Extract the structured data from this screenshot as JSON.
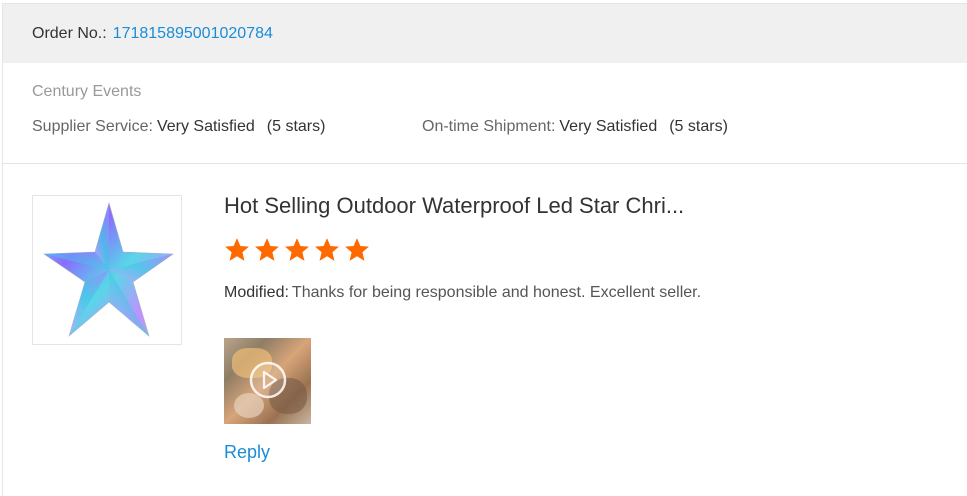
{
  "order": {
    "label": "Order No.:",
    "number": "171815895001020784"
  },
  "supplier": {
    "name": "Century Events",
    "service": {
      "label": "Supplier Service:",
      "value": "Very Satisfied",
      "stars_text": "(5 stars)"
    },
    "shipment": {
      "label": "On-time Shipment:",
      "value": "Very Satisfied",
      "stars_text": "(5 stars)"
    }
  },
  "product": {
    "image_icon": "star-ornament-image",
    "title": "Hot Selling Outdoor Waterproof Led Star Chri..."
  },
  "rating": {
    "stars": 5,
    "max": 5,
    "color": "#ff6a00"
  },
  "review": {
    "label": "Modified:",
    "text": "Thanks for being responsible and honest. Excellent seller."
  },
  "media": {
    "icon": "play-icon"
  },
  "actions": {
    "reply_label": "Reply"
  },
  "colors": {
    "link": "#1a8cd8",
    "star": "#ff6a00",
    "header_bg": "#f0f0f0"
  }
}
